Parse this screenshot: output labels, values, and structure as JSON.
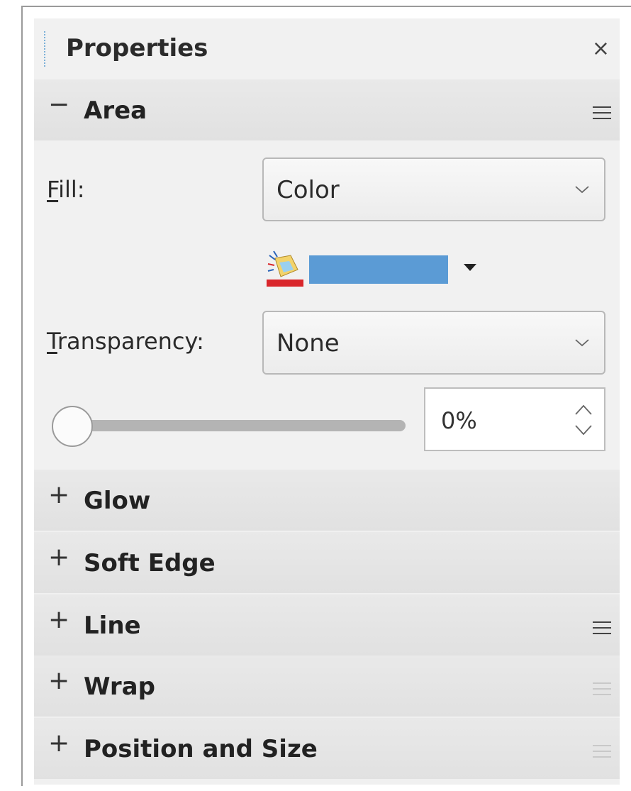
{
  "panel": {
    "title": "Properties",
    "close_glyph": "×"
  },
  "icons": {
    "close": "close-icon",
    "collapse": "minus-icon",
    "expand": "plus-icon",
    "menu": "menu-icon",
    "chevron": "chevron-down-icon",
    "color": "color-picker-icon"
  },
  "area": {
    "toggle": "−",
    "label": "Area",
    "fill_label_accel": "F",
    "fill_label_rest": "ill:",
    "fill_value": "Color",
    "fill_color": "#5b9bd5",
    "transparency_label_accel": "T",
    "transparency_label_rest": "ransparency:",
    "transparency_value": "None",
    "transparency_percent": "0%",
    "slider_value_percent": 0
  },
  "sections": [
    {
      "toggle": "+",
      "label": "Glow",
      "has_menu": false
    },
    {
      "toggle": "+",
      "label": "Soft Edge",
      "has_menu": false
    },
    {
      "toggle": "+",
      "label": "Line",
      "has_menu": true,
      "menu_faded": false
    },
    {
      "toggle": "+",
      "label": "Wrap",
      "has_menu": true,
      "menu_faded": true
    },
    {
      "toggle": "+",
      "label": "Position and Size",
      "has_menu": true,
      "menu_faded": true
    }
  ]
}
